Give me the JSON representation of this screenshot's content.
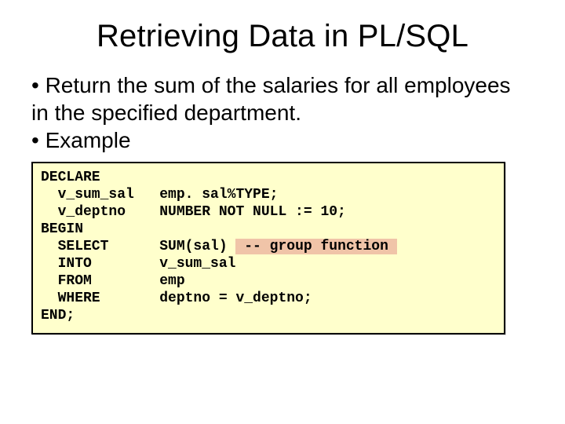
{
  "title": "Retrieving Data in PL/SQL",
  "bullets": {
    "b1": "• Return the sum of the salaries for all employees in the specified department.",
    "b2": "• Example"
  },
  "code": {
    "l1": "DECLARE",
    "l2": "  v_sum_sal   emp. sal%TYPE;",
    "l3": "  v_deptno    NUMBER NOT NULL := 10;",
    "l4": "BEGIN",
    "l5a": "  SELECT      SUM(sal) ",
    "l5b": " -- group function ",
    "l6": "  INTO        v_sum_sal",
    "l7": "  FROM        emp",
    "l8": "  WHERE       deptno = v_deptno;",
    "l9": "END;"
  }
}
